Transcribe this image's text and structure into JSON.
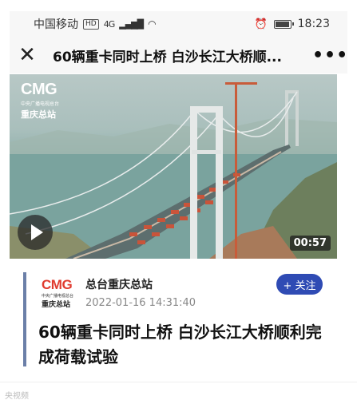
{
  "status_bar": {
    "carrier": "中国移动",
    "hd_badge": "HD",
    "network": "4G",
    "time": "18:23",
    "battery_level": 0.85
  },
  "nav": {
    "close_icon": "close-icon",
    "title": "60辆重卡同时上桥 白沙长江大桥顺...",
    "more_icon": "more-icon"
  },
  "video": {
    "logo_main": "CMG",
    "logo_tiny": "中央广播电视总台",
    "logo_station": "重庆总站",
    "duration": "00:57"
  },
  "article": {
    "author_logo_main": "CMG",
    "author_logo_tiny": "中央广播电视总台",
    "author_logo_station": "重庆总站",
    "author_name": "总台重庆总站",
    "follow_label": "+ 关注",
    "publish_time": "2022-01-16 14:31:40",
    "headline": "60辆重卡同时上桥 白沙长江大桥顺利完成荷载试验"
  },
  "footer": {
    "watermark": "央视频"
  },
  "colors": {
    "accent": "#2f4bb4",
    "brand_red": "#e03b2f",
    "card_bar": "#6b7fa8"
  }
}
